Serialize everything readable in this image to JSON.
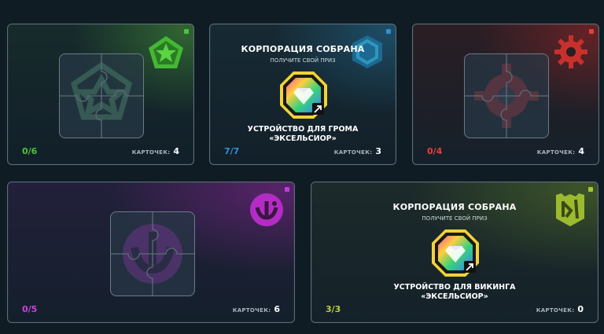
{
  "cards": [
    {
      "id": "green",
      "accent": "#4fc23a",
      "emblem": "star-pentagon-emblem-icon",
      "progress": "0/6",
      "cards_label": "КАРТОЧЕК:",
      "cards_count": "4"
    },
    {
      "id": "blue",
      "accent": "#2e90d8",
      "emblem": "hexagon-emblem-icon",
      "title": "КОРПОРАЦИЯ СОБРАНА",
      "subtitle": "ПОЛУЧИТЕ СВОЙ ПРИЗ",
      "prize_line1": "УСТРОЙСТВО ДЛЯ ГРОМА",
      "prize_line2": "«ЭКСЕЛЬСИОР»",
      "progress": "7/7",
      "cards_label": "КАРТОЧЕК:",
      "cards_count": "3"
    },
    {
      "id": "red",
      "accent": "#e0413c",
      "emblem": "gear-emblem-icon",
      "progress": "0/4",
      "cards_label": "КАРТОЧЕК:",
      "cards_count": "4"
    },
    {
      "id": "purple",
      "accent": "#c33bd6",
      "emblem": "round-emblem-icon",
      "progress": "0/5",
      "cards_label": "КАРТОЧЕК:",
      "cards_count": "6"
    },
    {
      "id": "lime",
      "accent": "#a7c438",
      "emblem": "shield-emblem-icon",
      "title": "КОРПОРАЦИЯ СОБРАНА",
      "subtitle": "ПОЛУЧИТЕ СВОЙ ПРИЗ",
      "prize_line1": "УСТРОЙСТВО ДЛЯ ВИКИНГА",
      "prize_line2": "«ЭКСЕЛЬСИОР»",
      "progress": "3/3",
      "cards_label": "КАРТОЧЕК:",
      "cards_count": "0"
    }
  ]
}
